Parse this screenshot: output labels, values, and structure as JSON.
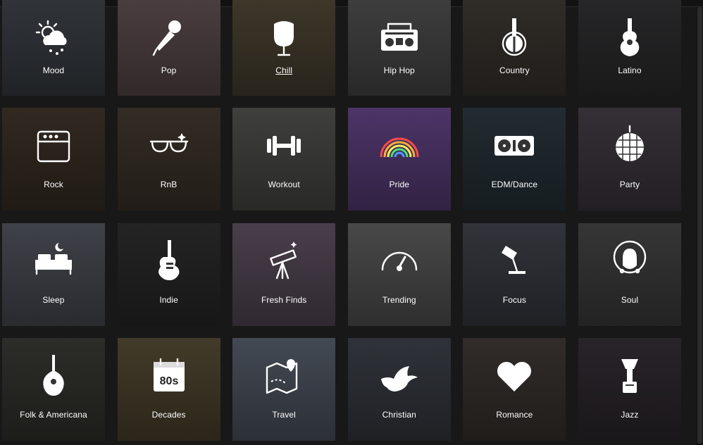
{
  "colors": {
    "accent": "#1db954",
    "background": "#181818"
  },
  "categories": [
    {
      "label": "Mood",
      "icon": "weather-icon",
      "bg": "#3a3f45"
    },
    {
      "label": "Pop",
      "icon": "microphone-icon",
      "bg": "#5a4a4c"
    },
    {
      "label": "Chill",
      "icon": "egg-chair-icon",
      "bg": "#4a4232",
      "underlined": true
    },
    {
      "label": "Hip Hop",
      "icon": "boombox-icon",
      "bg": "#4a4a4a"
    },
    {
      "label": "Country",
      "icon": "banjo-icon",
      "bg": "#3a3530"
    },
    {
      "label": "Latino",
      "icon": "guitar-icon",
      "bg": "#2e2e30"
    },
    {
      "label": "Rock",
      "icon": "amplifier-icon",
      "bg": "#3a3026"
    },
    {
      "label": "RnB",
      "icon": "sunglasses-icon",
      "bg": "#3d342c"
    },
    {
      "label": "Workout",
      "icon": "dumbbell-icon",
      "bg": "#4a4a48"
    },
    {
      "label": "Pride",
      "icon": "rainbow-icon",
      "bg": "#5a3e7a"
    },
    {
      "label": "EDM/Dance",
      "icon": "turntable-icon",
      "bg": "#28333a"
    },
    {
      "label": "Party",
      "icon": "disco-ball-icon",
      "bg": "#3e3840"
    },
    {
      "label": "Sleep",
      "icon": "bed-icon",
      "bg": "#4a4d55"
    },
    {
      "label": "Indie",
      "icon": "electric-guitar-icon",
      "bg": "#2a2a2a"
    },
    {
      "label": "Fresh Finds",
      "icon": "telescope-icon",
      "bg": "#564a58"
    },
    {
      "label": "Trending",
      "icon": "speedometer-icon",
      "bg": "#555555"
    },
    {
      "label": "Focus",
      "icon": "desk-lamp-icon",
      "bg": "#3a3c44"
    },
    {
      "label": "Soul",
      "icon": "afro-silhouette-icon",
      "bg": "#3f3f3f"
    },
    {
      "label": "Folk & Americana",
      "icon": "mandolin-icon",
      "bg": "#34352f"
    },
    {
      "label": "Decades",
      "icon": "calendar-80s-icon",
      "bg": "#4f4530"
    },
    {
      "label": "Travel",
      "icon": "map-pin-icon",
      "bg": "#4f5662"
    },
    {
      "label": "Christian",
      "icon": "dove-icon",
      "bg": "#373b42"
    },
    {
      "label": "Romance",
      "icon": "heart-icon",
      "bg": "#3a3430"
    },
    {
      "label": "Jazz",
      "icon": "saxophone-icon",
      "bg": "#2f2a30"
    }
  ]
}
